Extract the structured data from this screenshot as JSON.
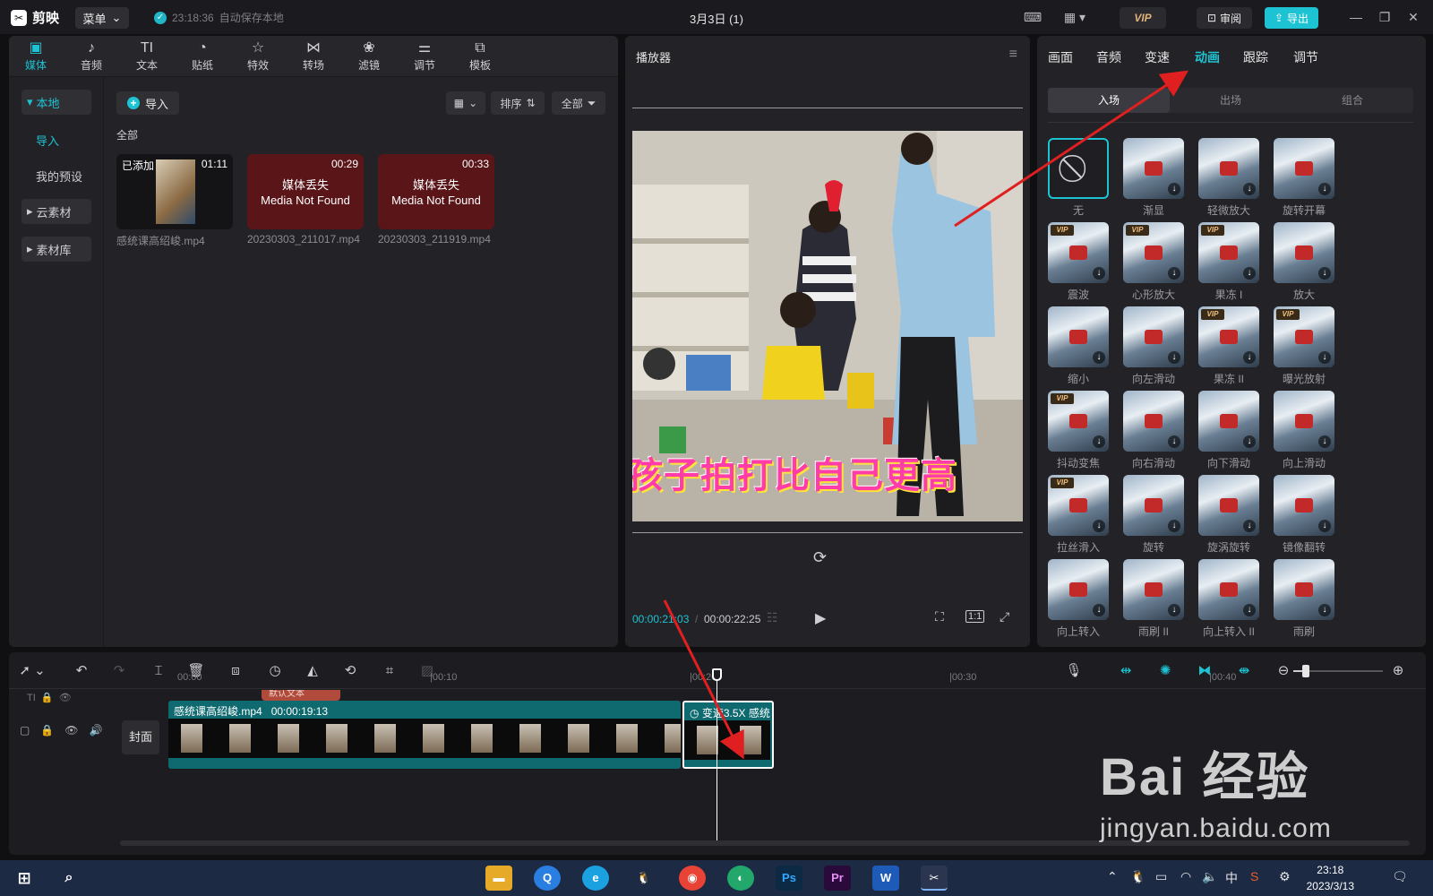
{
  "titlebar": {
    "logo": "剪映",
    "menu_label": "菜单",
    "save_time": "23:18:36",
    "save_text": "自动保存本地",
    "doc_title": "3月3日 (1)",
    "vip_label": "VIP",
    "review_label": "审阅",
    "export_label": "导出"
  },
  "media_tabs": [
    {
      "label": "媒体",
      "icon": "media-icon"
    },
    {
      "label": "音频",
      "icon": "audio-icon"
    },
    {
      "label": "文本",
      "icon": "text-icon"
    },
    {
      "label": "贴纸",
      "icon": "sticker-icon"
    },
    {
      "label": "特效",
      "icon": "effects-icon"
    },
    {
      "label": "转场",
      "icon": "transition-icon"
    },
    {
      "label": "滤镜",
      "icon": "filter-icon"
    },
    {
      "label": "调节",
      "icon": "adjust-icon"
    },
    {
      "label": "模板",
      "icon": "template-icon"
    }
  ],
  "side_nav": {
    "local": "本地",
    "import": "导入",
    "presets": "我的预设",
    "cloud": "云素材",
    "library": "素材库"
  },
  "media_toolbar": {
    "import_label": "导入",
    "sort_label": "排序",
    "filter_label": "全部"
  },
  "media_section": "全部",
  "media_items": [
    {
      "name": "感统课高绍峻.mp4",
      "duration": "01:11",
      "badge": "已添加",
      "missing_cn": "",
      "missing_en": ""
    },
    {
      "name": "20230303_211017.mp4",
      "duration": "00:29",
      "badge": "",
      "missing_cn": "媒体丢失",
      "missing_en": "Media Not Found"
    },
    {
      "name": "20230303_211919.mp4",
      "duration": "00:33",
      "badge": "",
      "missing_cn": "媒体丢失",
      "missing_en": "Media Not Found"
    }
  ],
  "player": {
    "title": "播放器",
    "subtitle_text": "孩子拍打比自己更高",
    "current_time": "00:00:21:03",
    "total_time": "00:00:22:25",
    "ratio_label": "1:1"
  },
  "props": {
    "tabs": [
      "画面",
      "音频",
      "变速",
      "动画",
      "跟踪",
      "调节"
    ],
    "active_tab": "动画",
    "segments": [
      "入场",
      "出场",
      "组合"
    ],
    "animations": [
      {
        "label": "无",
        "vip": false
      },
      {
        "label": "渐显",
        "vip": false
      },
      {
        "label": "轻微放大",
        "vip": false
      },
      {
        "label": "旋转开幕",
        "vip": false
      },
      {
        "label": "震波",
        "vip": true
      },
      {
        "label": "心形放大",
        "vip": true
      },
      {
        "label": "果冻 I",
        "vip": true
      },
      {
        "label": "放大",
        "vip": false
      },
      {
        "label": "缩小",
        "vip": false
      },
      {
        "label": "向左滑动",
        "vip": false
      },
      {
        "label": "果冻 II",
        "vip": true
      },
      {
        "label": "曝光放射",
        "vip": true
      },
      {
        "label": "抖动变焦",
        "vip": true
      },
      {
        "label": "向右滑动",
        "vip": false
      },
      {
        "label": "向下滑动",
        "vip": false
      },
      {
        "label": "向上滑动",
        "vip": false
      },
      {
        "label": "拉丝滑入",
        "vip": true
      },
      {
        "label": "旋转",
        "vip": false
      },
      {
        "label": "旋涡旋转",
        "vip": false
      },
      {
        "label": "镜像翻转",
        "vip": false
      },
      {
        "label": "向上转入",
        "vip": false
      },
      {
        "label": "雨刷 II",
        "vip": false
      },
      {
        "label": "向上转入 II",
        "vip": false
      },
      {
        "label": "雨刷",
        "vip": false
      }
    ]
  },
  "timeline": {
    "ticks": [
      "00:00",
      "|00:10",
      "|00:20",
      "|00:30",
      "|00:40"
    ],
    "text_clip": "默认文本",
    "cover_label": "封面",
    "clip1_name": "感统课高绍峻.mp4",
    "clip1_duration": "00:00:19:13",
    "clip2_speed": "变速3.5X",
    "clip2_name": "感统"
  },
  "taskbar": {
    "time": "23:18",
    "date": "2023/3/13",
    "ime": "中",
    "apps": [
      "explorer",
      "search",
      "edge",
      "qq",
      "chrome",
      "edge-dev",
      "Ps",
      "Pr",
      "W",
      "capcut"
    ]
  },
  "watermark": {
    "main": "Bai 经验",
    "sub": "jingyan.baidu.com"
  },
  "colors": {
    "accent": "#1ec3d3",
    "annotation_arrow": "#e02020"
  }
}
